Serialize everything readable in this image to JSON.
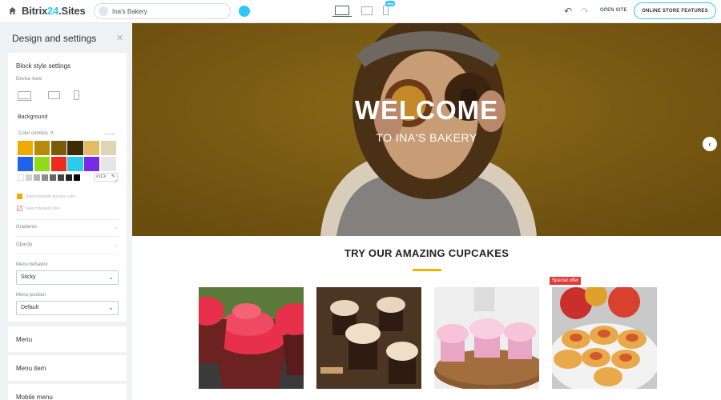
{
  "app": {
    "logo_main": "Bitrix",
    "logo_num": "24",
    "logo_suffix": ".Sites",
    "site_name": "Ina's Bakery",
    "new_badge": "New",
    "open_site": "OPEN SITE",
    "features_button": "ONLINE STORE FEATURES"
  },
  "sidebar": {
    "title": "Design and settings",
    "block_title": "Block style settings",
    "device_view": "Device view",
    "background": "Background",
    "color_combos": "Color combos",
    "store_label": "STORE",
    "swatches": [
      "#f0ab00",
      "#b88a0b",
      "#7a5c08",
      "#3b2c06",
      "#e3bb66",
      "#e0d4b4",
      "#1e63e9",
      "#92d91a",
      "#ee2b1c",
      "#2bcbe9",
      "#7a2ae4",
      "#e6e6e6"
    ],
    "grays": [
      "#ffffff",
      "#d5d5d5",
      "#b3b3b3",
      "#8c8c8c",
      "#666666",
      "#444444",
      "#222222",
      "#000000"
    ],
    "hex_value": "#1CX",
    "primary_color": "Select website primary color",
    "default_color": "Select default color",
    "gradients": "Gradients",
    "opacity": "Opacity",
    "menu_behavior_label": "Menu behavior",
    "menu_behavior_value": "Sticky",
    "menu_position_label": "Menu position",
    "menu_position_value": "Default",
    "sections": [
      "Menu",
      "Menu item",
      "Mobile menu"
    ]
  },
  "hero": {
    "title": "WELCOME",
    "subtitle": "TO INA'S BAKERY"
  },
  "products": {
    "title": "TRY OUR AMAZING CUPCAKES",
    "offer_badge": "Special offer"
  }
}
